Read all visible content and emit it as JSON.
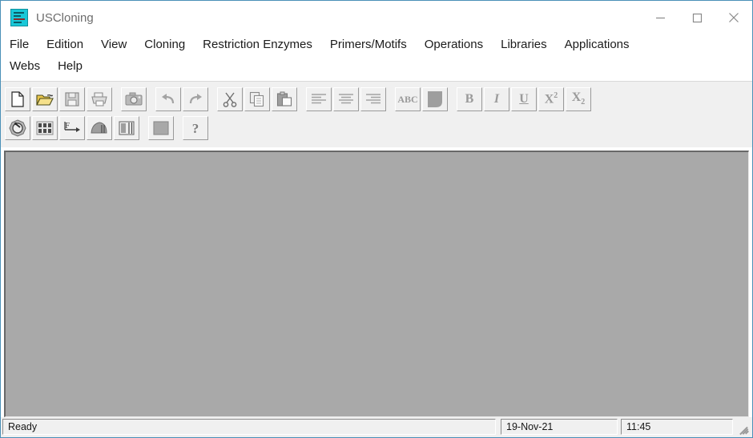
{
  "window": {
    "title": "USCloning",
    "icon": "sequence-gel-icon",
    "controls": {
      "minimize": "Minimize",
      "maximize": "Maximize",
      "close": "Close"
    }
  },
  "menubar": {
    "row1": [
      {
        "label": "File"
      },
      {
        "label": "Edition"
      },
      {
        "label": "View"
      },
      {
        "label": "Cloning"
      },
      {
        "label": "Restriction Enzymes"
      },
      {
        "label": "Primers/Motifs"
      },
      {
        "label": "Operations"
      },
      {
        "label": "Libraries"
      },
      {
        "label": "Applications"
      }
    ],
    "row2": [
      {
        "label": "Webs"
      },
      {
        "label": "Help"
      }
    ]
  },
  "toolbar": {
    "row1": [
      {
        "name": "new-document-icon",
        "tooltip": "New",
        "enabled": true
      },
      {
        "name": "open-folder-icon",
        "tooltip": "Open",
        "enabled": true
      },
      {
        "name": "save-floppy-icon",
        "tooltip": "Save",
        "enabled": false
      },
      {
        "name": "print-icon",
        "tooltip": "Print",
        "enabled": false
      },
      {
        "name": "camera-icon",
        "tooltip": "Snapshot",
        "enabled": false
      },
      {
        "name": "undo-icon",
        "tooltip": "Undo",
        "enabled": false
      },
      {
        "name": "redo-icon",
        "tooltip": "Redo",
        "enabled": false
      },
      {
        "name": "cut-scissors-icon",
        "tooltip": "Cut",
        "enabled": false
      },
      {
        "name": "copy-icon",
        "tooltip": "Copy",
        "enabled": false
      },
      {
        "name": "paste-icon",
        "tooltip": "Paste",
        "enabled": false
      },
      {
        "name": "align-left-icon",
        "tooltip": "Align Left",
        "enabled": false
      },
      {
        "name": "align-center-icon",
        "tooltip": "Align Center",
        "enabled": false
      },
      {
        "name": "align-right-icon",
        "tooltip": "Align Right",
        "enabled": false
      },
      {
        "name": "spellcheck-abc-icon",
        "label": "ABC",
        "tooltip": "Spell Check",
        "enabled": false
      },
      {
        "name": "highlight-blob-icon",
        "tooltip": "Highlight",
        "enabled": false
      },
      {
        "name": "bold-icon",
        "label": "B",
        "tooltip": "Bold",
        "enabled": false
      },
      {
        "name": "italic-icon",
        "label": "I",
        "tooltip": "Italic",
        "enabled": false
      },
      {
        "name": "underline-icon",
        "label": "U",
        "tooltip": "Underline",
        "enabled": false
      },
      {
        "name": "superscript-icon",
        "label": "X2",
        "tooltip": "Superscript",
        "enabled": false
      },
      {
        "name": "subscript-icon",
        "label": "X2",
        "tooltip": "Subscript",
        "enabled": false
      }
    ],
    "row2": [
      {
        "name": "plasmid-circle-icon",
        "tooltip": "Plasmid Map",
        "enabled": true
      },
      {
        "name": "sequence-atg-tac-icon",
        "tooltip": "Sequence",
        "enabled": true
      },
      {
        "name": "translate-frame-icon",
        "label": "F",
        "tooltip": "Reading Frame",
        "enabled": true
      },
      {
        "name": "enzyme-icon",
        "tooltip": "Enzymes",
        "enabled": true
      },
      {
        "name": "gel-lane-icon",
        "tooltip": "Gel",
        "enabled": true
      },
      {
        "name": "blank-panel-icon",
        "tooltip": "Panel",
        "enabled": true
      },
      {
        "name": "help-question-icon",
        "label": "?",
        "tooltip": "Help",
        "enabled": true
      }
    ]
  },
  "statusbar": {
    "status": "Ready",
    "date": "19-Nov-21",
    "time": "11:45"
  }
}
